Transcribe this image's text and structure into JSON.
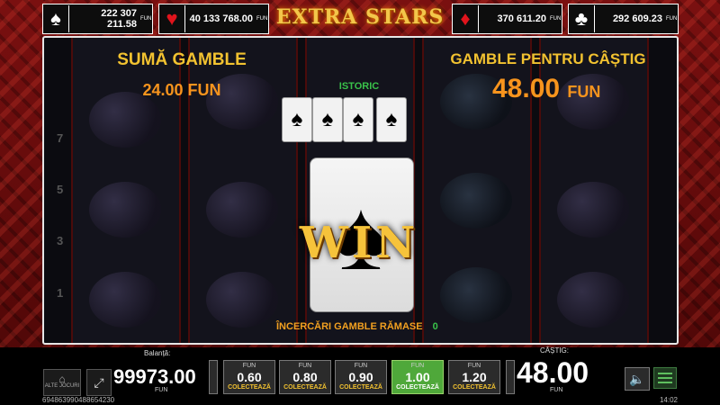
{
  "jackpots": [
    {
      "suit": "♠",
      "value": "222 307 211.58",
      "currency": "FUN"
    },
    {
      "suit": "♥",
      "value": "40 133 768.00",
      "currency": "FUN"
    },
    {
      "suit": "♦",
      "value": "370 611.20",
      "currency": "FUN"
    },
    {
      "suit": "♣",
      "value": "292 609.23",
      "currency": "FUN"
    }
  ],
  "logo": "EXTRA STARS",
  "gamble": {
    "amount_label": "SUMĂ GAMBLE",
    "amount_value": "24.00 FUN",
    "win_label": "GAMBLE PENTRU CÂȘTIG",
    "win_value": "48.00",
    "win_currency": "FUN",
    "history_label": "ISTORIC",
    "history": [
      "♠",
      "♠",
      "♠",
      "♠"
    ],
    "card_suit": "♠",
    "result": "WIN",
    "remaining_label": "ÎNCERCĂRI GAMBLE RĂMASE",
    "remaining_value": "0"
  },
  "reels": {
    "line_numbers_left": [
      "7",
      "5",
      "3",
      "1"
    ]
  },
  "bottom": {
    "other_games": "ALTE JOCURI",
    "balance_label": "Balanță:",
    "balance_value": "99973.00",
    "balance_currency": "FUN",
    "bets": [
      {
        "currency": "FUN",
        "value": "0.60",
        "action": "COLECTEAZĂ",
        "active": false
      },
      {
        "currency": "FUN",
        "value": "0.80",
        "action": "COLECTEAZĂ",
        "active": false
      },
      {
        "currency": "FUN",
        "value": "0.90",
        "action": "COLECTEAZĂ",
        "active": false
      },
      {
        "currency": "FUN",
        "value": "1.00",
        "action": "COLECTEAZĂ",
        "active": true
      },
      {
        "currency": "FUN",
        "value": "1.20",
        "action": "COLECTEAZĂ",
        "active": false
      }
    ],
    "win_label": "CÂȘTIG:",
    "win_value": "48.00",
    "win_currency": "FUN"
  },
  "footer": {
    "session_id": "694863990488654230",
    "time": "14:02"
  },
  "colors": {
    "accent_gold": "#f2c230",
    "accent_orange": "#f7941d",
    "active_green": "#4fa83a"
  }
}
